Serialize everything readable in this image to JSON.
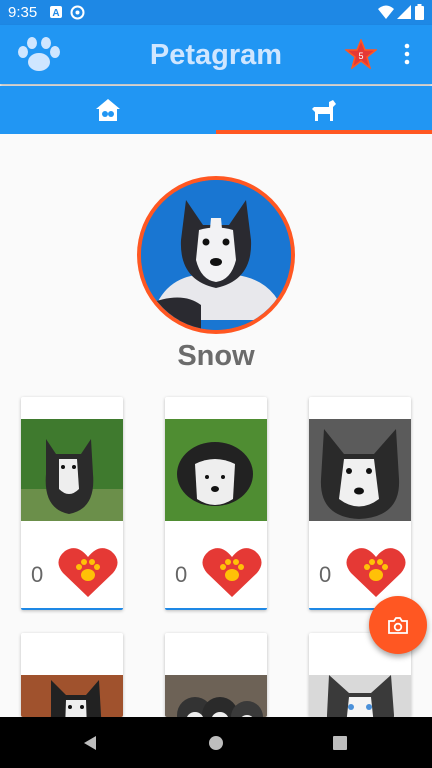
{
  "status_bar": {
    "time": "9:35"
  },
  "app_bar": {
    "title": "Petagram"
  },
  "tabs": [
    {
      "icon": "home-pet-icon"
    },
    {
      "icon": "dog-icon",
      "selected": true
    }
  ],
  "profile": {
    "name": "Snow"
  },
  "photos": [
    {
      "likes": "0",
      "variant": "a"
    },
    {
      "likes": "0",
      "variant": "b"
    },
    {
      "likes": "0",
      "variant": "c"
    },
    {
      "likes": "",
      "variant": "d"
    },
    {
      "likes": "",
      "variant": "e"
    },
    {
      "likes": "",
      "variant": "f"
    }
  ],
  "colors": {
    "primary": "#2196f3",
    "accent": "#ff5722",
    "heart": "#e53935",
    "paw": "#ffc107"
  }
}
